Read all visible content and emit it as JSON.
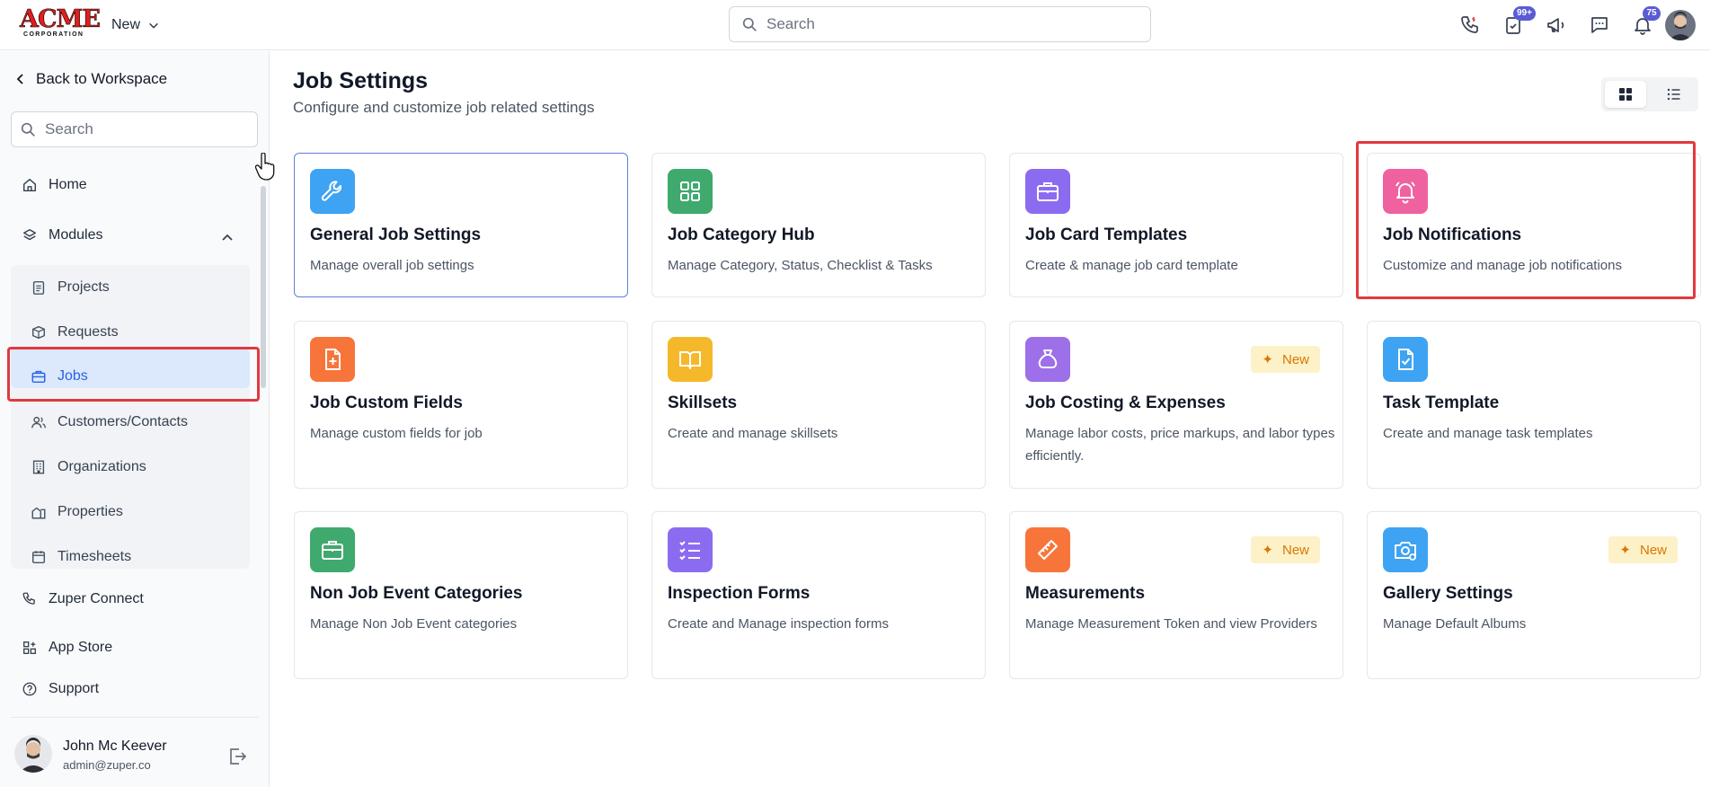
{
  "header": {
    "logo_main": "ACME",
    "logo_sub": "CORPORATION",
    "new_label": "New",
    "search_placeholder": "Search",
    "icons": [
      "phone-icon",
      "tasks-icon",
      "megaphone-icon",
      "chat-icon",
      "bell-icon"
    ],
    "tasks_badge": "99+",
    "notifications_badge": "75"
  },
  "sidebar": {
    "back_label": "Back to Workspace",
    "search_placeholder": "Search",
    "home": "Home",
    "modules": "Modules",
    "sub_items": [
      "Projects",
      "Requests",
      "Jobs",
      "Customers/Contacts",
      "Organizations",
      "Properties",
      "Timesheets"
    ],
    "active_item": "Jobs",
    "zuper_connect": "Zuper Connect",
    "app_store": "App Store",
    "support": "Support",
    "user_name": "John Mc Keever",
    "user_email": "admin@zuper.co"
  },
  "main": {
    "title": "Job Settings",
    "subtitle": "Configure and customize job related settings",
    "view_modes": [
      "grid",
      "list"
    ],
    "active_view": "grid",
    "cards": [
      {
        "title": "General Job Settings",
        "desc": "Manage overall job settings",
        "icon": "wrench-icon",
        "color": "#3ea3f2"
      },
      {
        "title": "Job Category Hub",
        "desc": "Manage Category, Status, Checklist & Tasks",
        "icon": "grid-icon",
        "color": "#3fa96e"
      },
      {
        "title": "Job Card Templates",
        "desc": "Create & manage job card template",
        "icon": "briefcase-icon",
        "color": "#8b6cf0"
      },
      {
        "title": "Job Notifications",
        "desc": "Customize and manage job notifications",
        "icon": "alarm-bell-icon",
        "color": "#f0619f"
      },
      {
        "title": "Job Custom Fields",
        "desc": "Manage custom fields for job",
        "icon": "file-plus-icon",
        "color": "#f7753a"
      },
      {
        "title": "Skillsets",
        "desc": "Create and manage skillsets",
        "icon": "book-icon",
        "color": "#f6b82b"
      },
      {
        "title": "Job Costing & Expenses",
        "desc": "Manage labor costs, price markups, and labor types efficiently.",
        "icon": "money-bag-icon",
        "color": "#9d6fe8",
        "badge": "New"
      },
      {
        "title": "Task Template",
        "desc": "Create and manage task templates",
        "icon": "file-check-icon",
        "color": "#3ea3f2"
      },
      {
        "title": "Non Job Event Categories",
        "desc": "Manage Non Job Event categories",
        "icon": "briefcase-icon",
        "color": "#3fa96e"
      },
      {
        "title": "Inspection Forms",
        "desc": "Create and Manage inspection forms",
        "icon": "checklist-icon",
        "color": "#8b6cf0"
      },
      {
        "title": "Measurements",
        "desc": "Manage Measurement Token and view Providers",
        "icon": "ruler-icon",
        "color": "#f7753a",
        "badge": "New"
      },
      {
        "title": "Gallery Settings",
        "desc": "Manage Default Albums",
        "icon": "camera-settings-icon",
        "color": "#3ea3f2",
        "badge": "New"
      }
    ]
  }
}
